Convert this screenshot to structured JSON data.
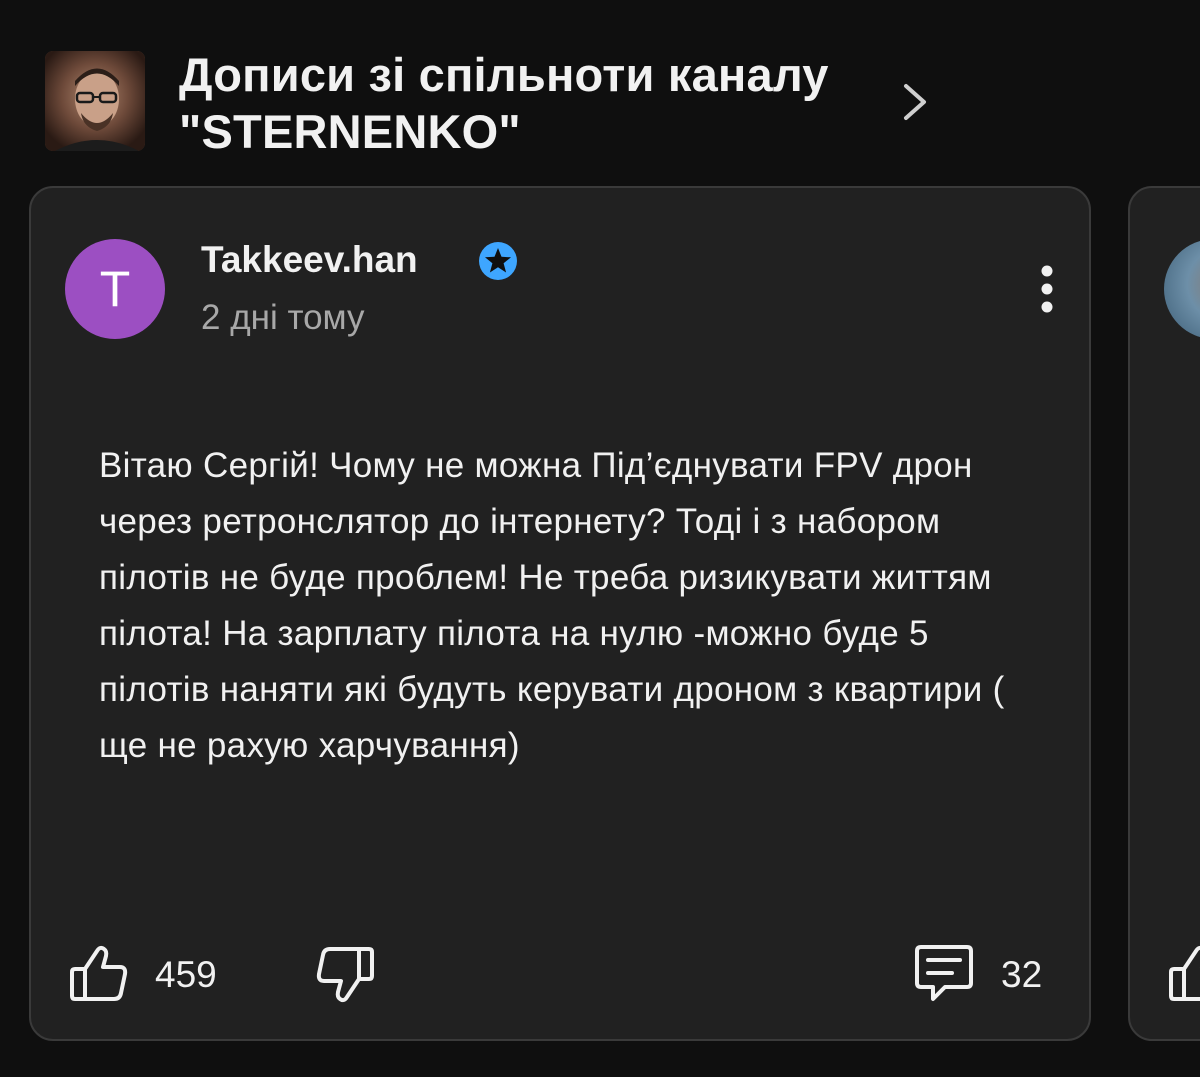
{
  "header": {
    "title": "Дописи зі спільноти каналу \"STERNENKO\"",
    "chevron_icon": "chevron-right-icon"
  },
  "post": {
    "author_initial": "T",
    "author_name": "Takkeev.han",
    "time": "2 дні тому",
    "body": "Вітаю Сергій! Чому не можна Під’єднувати FPV дрон через ретронслятор до інтернету? Тоді і з набором пілотів не буде проблем! Не треба ризикувати життям пілота! На зарплату пілота на нулю -можно буде 5 пілотів наняти які будуть керувати дроном з квартири ( ще не рахую харчування)",
    "likes": "459",
    "comments": "32",
    "avatar_color": "#9c4fc2",
    "badge_color": "#3ea6ff"
  },
  "colors": {
    "background": "#0f0f0f",
    "card": "#212121",
    "card_border": "#3a3a3a",
    "text_primary": "#f1f1f1",
    "text_secondary": "#a8a8a8"
  }
}
